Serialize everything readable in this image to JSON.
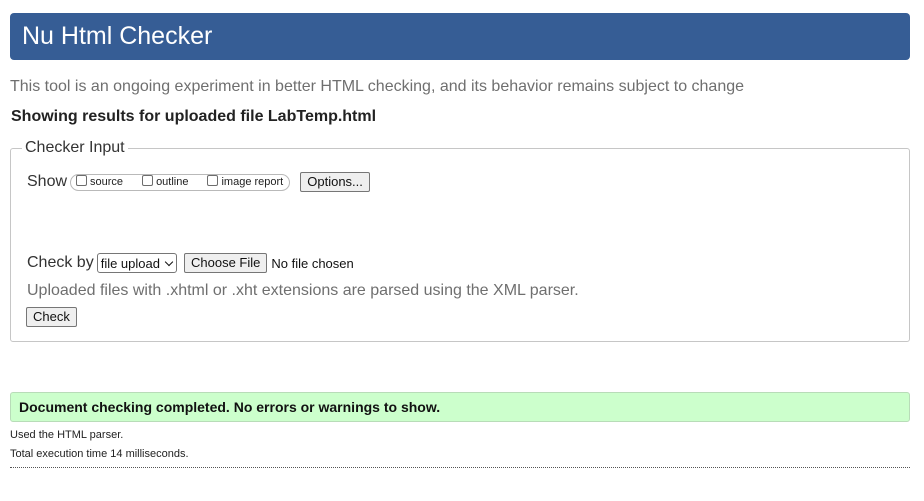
{
  "header": {
    "title": "Nu Html Checker",
    "background_color": "#365d95"
  },
  "intro": {
    "text": "This tool is an ongoing experiment in better HTML checking, and its behavior remains subject to change"
  },
  "results": {
    "heading": "Showing results for uploaded file LabTemp.html"
  },
  "checker_input": {
    "legend": "Checker Input",
    "show_label": "Show",
    "show_options": [
      {
        "label": "source",
        "checked": false
      },
      {
        "label": "outline",
        "checked": false
      },
      {
        "label": "image report",
        "checked": false
      }
    ],
    "options_button": "Options...",
    "check_by_label": "Check by",
    "check_by_selected": "file upload",
    "choose_file_button": "Choose File",
    "no_file_text": "No file chosen",
    "xml_note": "Uploaded files with .xhtml or .xht extensions are parsed using the XML parser.",
    "check_button": "Check"
  },
  "status": {
    "message": "Document checking completed. No errors or warnings to show.",
    "color": "#ccffcc"
  },
  "details": {
    "parser": "Used the HTML parser.",
    "execution_time": "Total execution time 14 milliseconds."
  },
  "icons": {
    "select_arrow": "chevron-down-icon"
  }
}
